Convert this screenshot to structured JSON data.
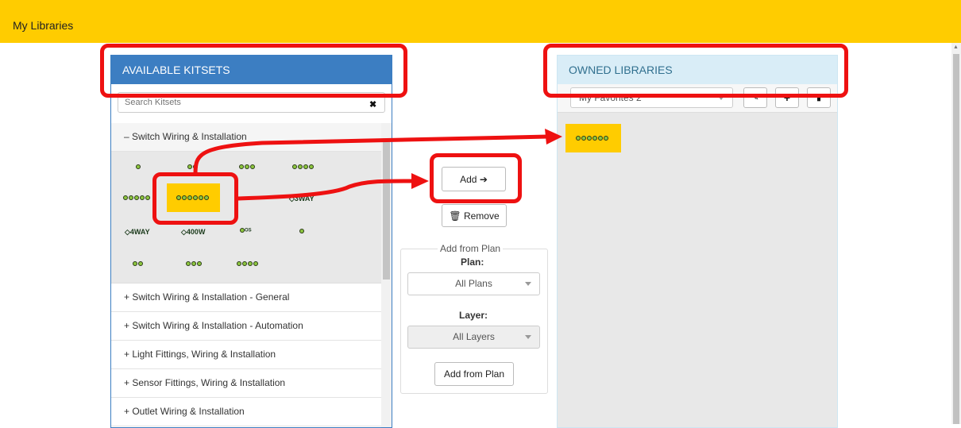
{
  "topbar": {
    "title": "My Libraries"
  },
  "kitsets": {
    "header": "AVAILABLE KITSETS",
    "search_placeholder": "Search Kitsets",
    "clear_icon": "✖",
    "expanded_item": "– Switch Wiring & Installation",
    "items": [
      "+ Switch Wiring & Installation - General",
      "+ Switch Wiring & Installation - Automation",
      "+ Light Fittings, Wiring & Installation",
      "+ Sensor Fittings, Wiring & Installation",
      "+ Outlet Wiring & Installation"
    ],
    "symbol_labels": {
      "way3": "3WAY",
      "way4": "4WAY",
      "w400": "400W",
      "os": "OS"
    }
  },
  "middle": {
    "add_label": "Add",
    "remove_label": "Remove",
    "plan_legend": "Add from Plan",
    "plan_label": "Plan:",
    "plan_value": "All Plans",
    "layer_label": "Layer:",
    "layer_value": "All Layers",
    "add_from_plan_label": "Add from Plan"
  },
  "owned": {
    "header": "OWNED LIBRARIES",
    "library_value": "My Favorites 2",
    "icons": [
      "pencil-icon",
      "plus-icon",
      "trash-icon"
    ]
  },
  "colors": {
    "accent_yellow": "#ffcc00",
    "primary_blue": "#3c7ec2",
    "info_bg": "#d9edf7",
    "annotation_red": "#ee1111",
    "symbol_green": "#8dc63f"
  }
}
